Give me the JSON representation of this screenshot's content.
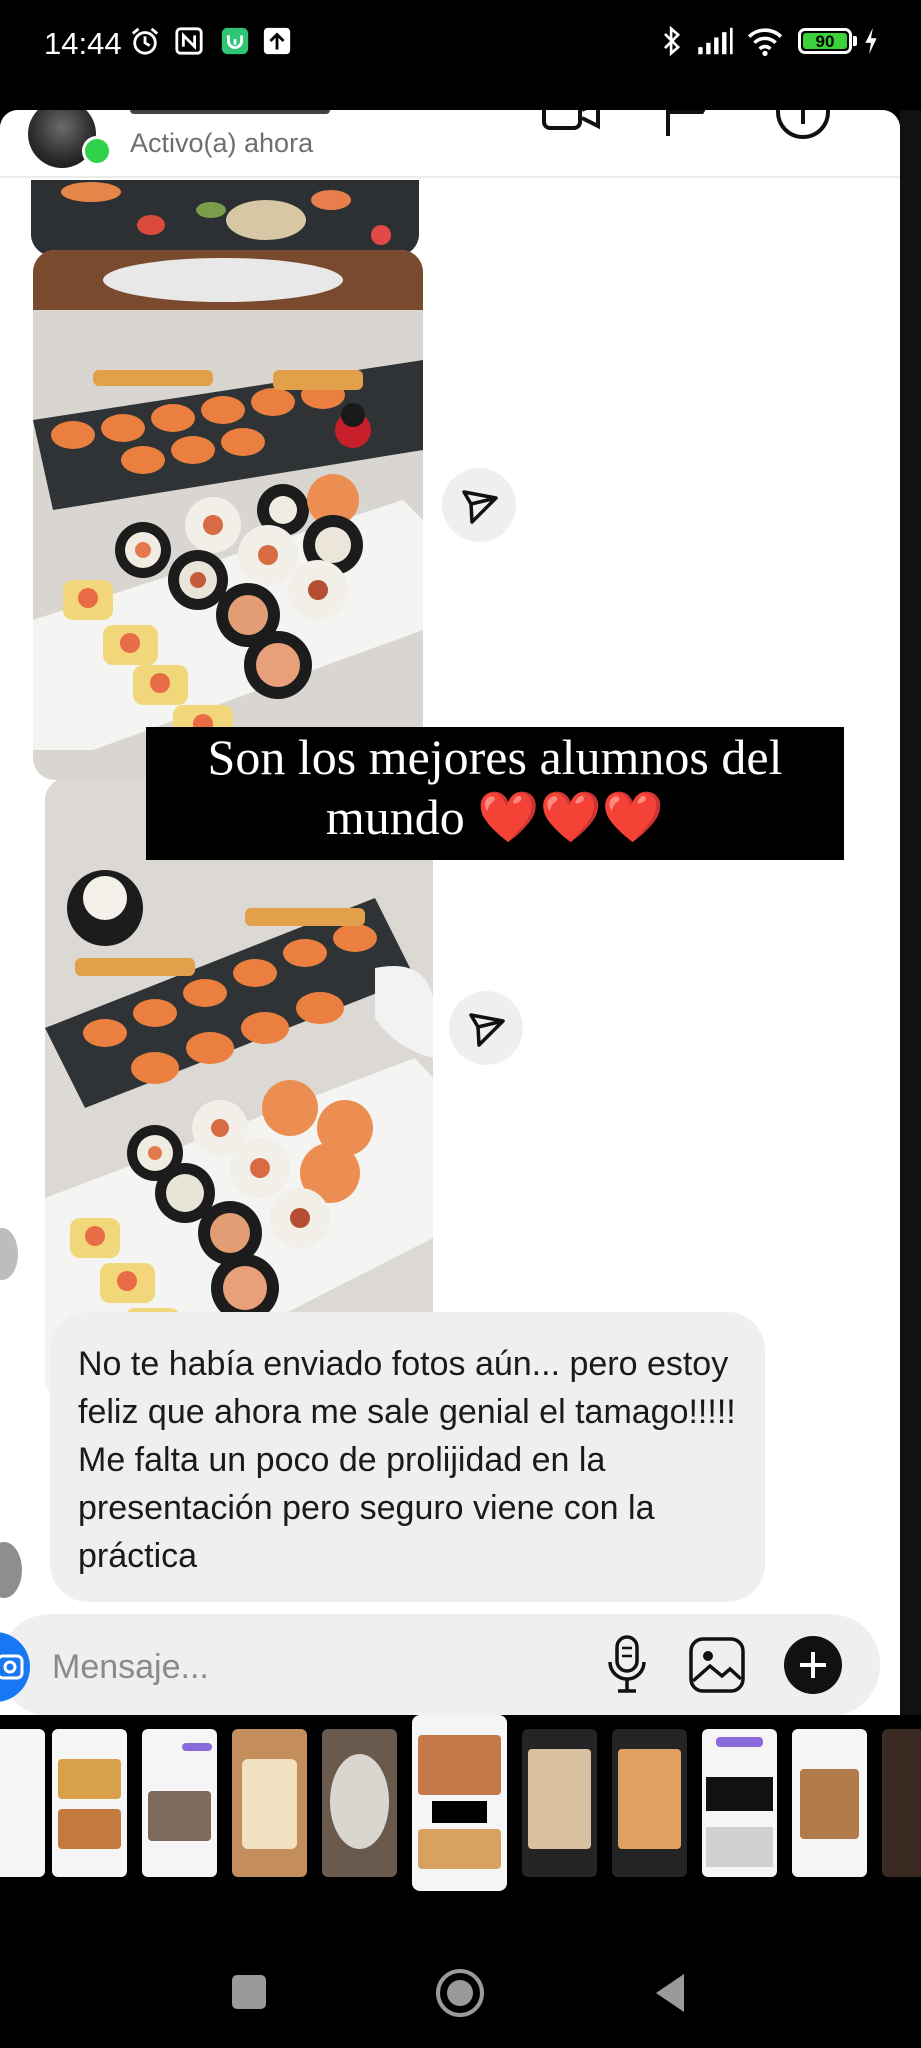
{
  "status_bar": {
    "time": "14:44",
    "battery": "90",
    "icons": [
      "alarm-icon",
      "nfc-icon",
      "app-notification-icon",
      "upload-icon",
      "bluetooth-icon",
      "signal-icon",
      "wifi-icon",
      "battery-icon",
      "charging-icon"
    ]
  },
  "chat": {
    "status": "Activo(a) ahora",
    "message": "No te había enviado fotos aún... pero estoy feliz que ahora me sale genial el tamago!!!!! Me falta un poco de prolijidad en la presentación pero seguro viene con la práctica",
    "input_placeholder": "Mensaje..."
  },
  "story": {
    "caption": "Son los mejores alumnos del mundo ❤️❤️❤️"
  },
  "colors": {
    "online": "#2fd24a",
    "bubble": "#efefef",
    "battery": "#3ad13a",
    "accent_blue": "#1877f2"
  }
}
